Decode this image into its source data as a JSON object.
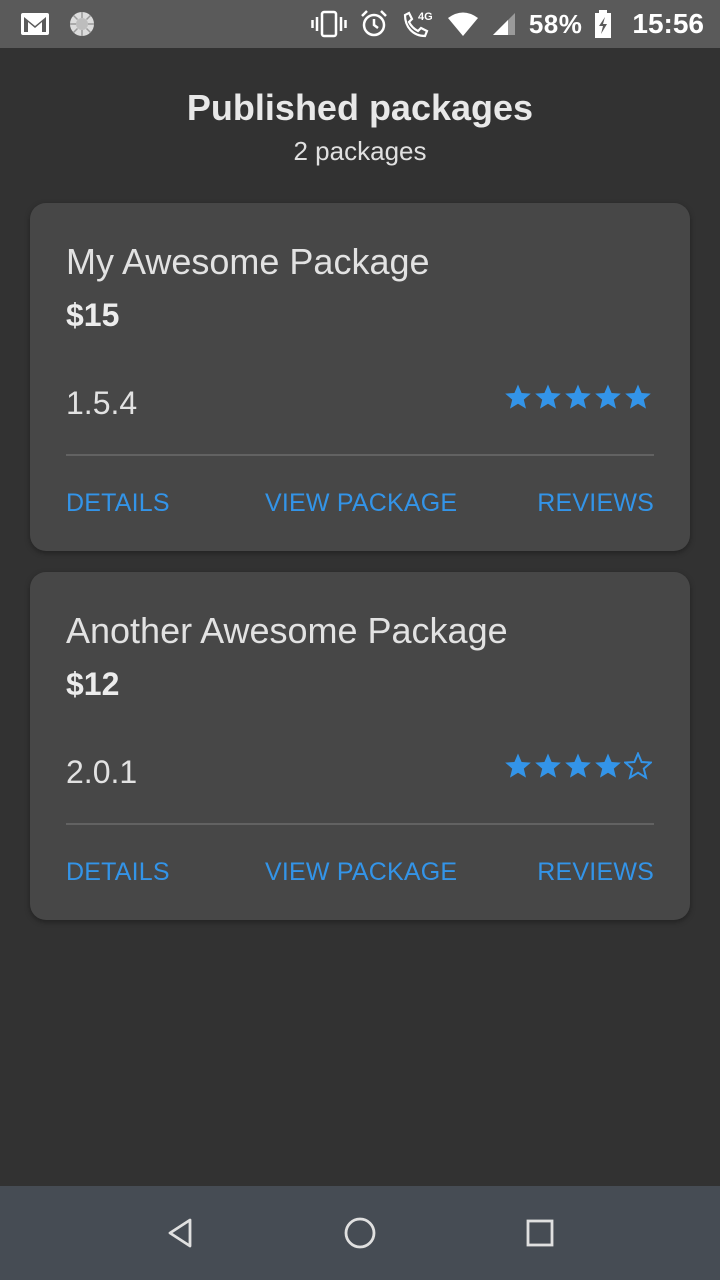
{
  "status_bar": {
    "battery": "58%",
    "time": "15:56",
    "network": "4G",
    "icons": [
      "gmail-icon",
      "spinner-icon",
      "vibrate-icon",
      "alarm-icon",
      "call-4g-icon",
      "wifi-icon",
      "signal-icon",
      "battery-icon"
    ]
  },
  "header": {
    "title": "Published packages",
    "subtitle": "2 packages"
  },
  "packages": [
    {
      "name": "My Awesome Package",
      "price": "$15",
      "version": "1.5.4",
      "rating": 5,
      "rating_max": 5,
      "actions": {
        "details": "DETAILS",
        "view": "VIEW PACKAGE",
        "reviews": "REVIEWS"
      }
    },
    {
      "name": "Another Awesome Package",
      "price": "$12",
      "version": "2.0.1",
      "rating": 4,
      "rating_max": 5,
      "actions": {
        "details": "DETAILS",
        "view": "VIEW PACKAGE",
        "reviews": "REVIEWS"
      }
    }
  ],
  "nav_bar": {
    "icons": [
      "back-icon",
      "home-icon",
      "recents-icon"
    ]
  },
  "colors": {
    "background": "#323232",
    "card": "#474747",
    "accent": "#3394e8",
    "status_bar": "#5a5a5a",
    "nav_bar": "#464c54"
  }
}
